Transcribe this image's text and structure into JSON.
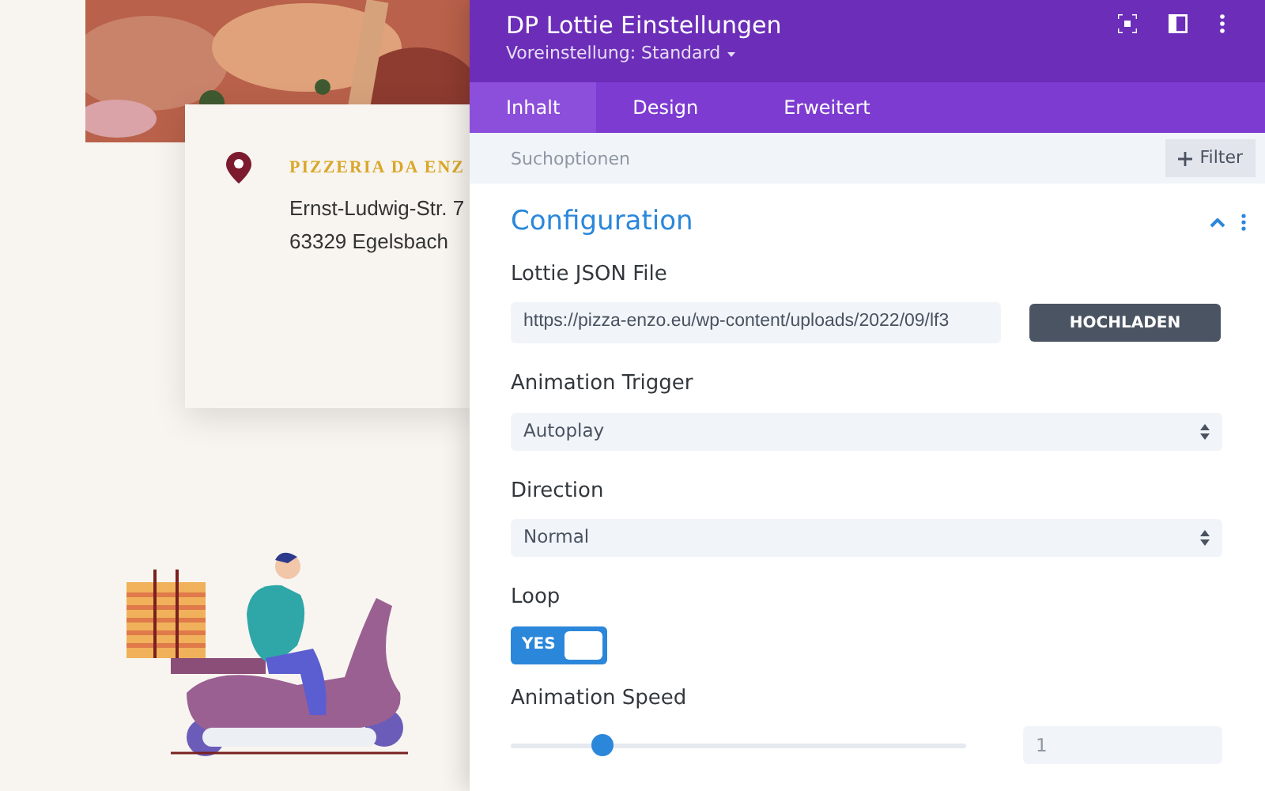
{
  "card": {
    "title": "PIZZERIA DA ENZ",
    "lines": [
      "Ernst-Ludwig-Str. 7",
      "63329 Egelsbach"
    ]
  },
  "panel": {
    "title": "DP Lottie Einstellungen",
    "preset": "Voreinstellung: Standard"
  },
  "tabs": [
    {
      "label": "Inhalt",
      "selected": true
    },
    {
      "label": "Design",
      "selected": false
    },
    {
      "label": "Erweitert",
      "selected": false
    }
  ],
  "search": {
    "placeholder": "Suchoptionen",
    "filter": "Filter"
  },
  "section": {
    "title": "Configuration",
    "expanded": true
  },
  "fields": [
    {
      "kind": "file",
      "label": "Lottie JSON File",
      "value": "https://pizza-enzo.eu/wp-content/uploads/2022/09/lf3",
      "button": "HOCHLADEN"
    },
    {
      "kind": "select",
      "label": "Animation Trigger",
      "value": "Autoplay"
    },
    {
      "kind": "select",
      "label": "Direction",
      "value": "Normal"
    },
    {
      "kind": "toggle",
      "label": "Loop",
      "on": true,
      "text": "YES"
    },
    {
      "kind": "slider",
      "label": "Animation Speed",
      "level": 0.2,
      "placeholder": "1"
    }
  ]
}
